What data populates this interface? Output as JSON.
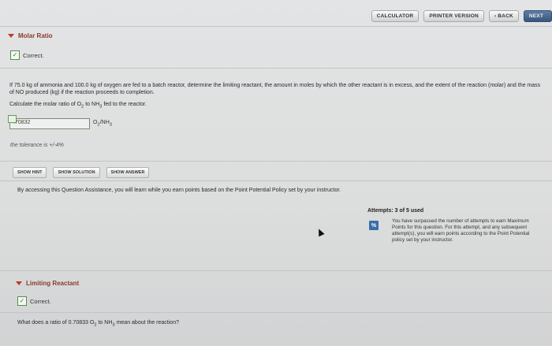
{
  "toolbar": {
    "calculator": "CALCULATOR",
    "printer_version": "PRINTER VERSION",
    "back": "‹ BACK",
    "next": "NEXT"
  },
  "molar_ratio": {
    "title": "Molar Ratio",
    "status": "Correct.",
    "problem": "If 75.0 kg of ammonia and 100.0 kg of oxygen are fed to a batch reactor, determine the limiting reactant, the amount in moles by which the other reactant is in excess, and the extent of the reaction (molar) and the mass of NO produced (kg) if the reaction proceeds to completion.",
    "question_prefix": "Calculate the molar ratio of O",
    "question_mid": " to NH",
    "question_suffix": " fed to the reactor.",
    "answer_value": ".70832",
    "unit_prefix": "O",
    "unit_mid": "/NH",
    "tolerance": "the tolerance is +/-4%"
  },
  "assistance": {
    "show_hint": "SHOW HINT",
    "show_solution": "SHOW SOLUTION",
    "show_answer": "SHOW ANSWER",
    "notice": "By accessing this Question Assistance, you will learn while you earn points based on the Point Potential Policy set by your instructor."
  },
  "attempts": {
    "label": "Attempts: 3 of 5 used",
    "icon_text": "%",
    "note": "You have surpassed the number of attempts to earn Maximum Points for this question. For this attempt, and any subsequent attempt(s), you will earn points according to the Point Potential policy set by your instructor."
  },
  "limiting_reactant": {
    "title": "Limiting Reactant",
    "status": "Correct.",
    "question_prefix": "What does a ratio of 0.70833 O",
    "question_mid": " to NH",
    "question_suffix": " mean about the reaction?"
  },
  "subscripts": {
    "two": "2",
    "three": "3"
  },
  "icons": {
    "expand": "triangle-down-icon",
    "check": "checkbox-check-icon",
    "percent": "percent-icon",
    "cursor": "mouse-cursor-icon"
  },
  "colors": {
    "section_title": "#8a3a2a",
    "triangle": "#c0392b",
    "percent_icon": "#3b6ea8",
    "check": "#2e7d32"
  }
}
